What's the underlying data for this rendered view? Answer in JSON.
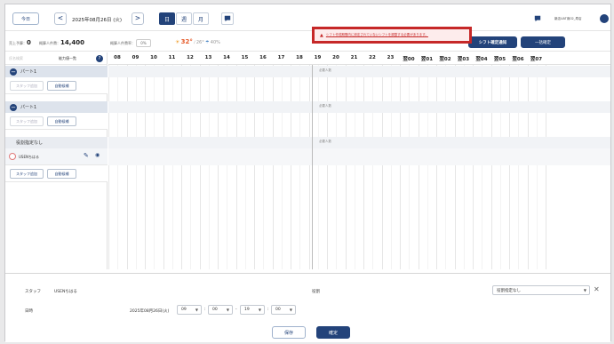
{
  "header": {
    "today_label": "今日",
    "prev_label": "<",
    "next_label": ">",
    "date": "2025年08月26日 (火)",
    "view_tabs": [
      "日",
      "週",
      "月"
    ],
    "user_name": "新店UAT用02_寿店"
  },
  "stats": {
    "sales_label": "売上予算：",
    "sales_value": "0",
    "labor_cost_label": "概算人件費：",
    "labor_cost_value": "14,400",
    "labor_ratio_label": "概算人件費率：",
    "labor_ratio_value": "0%",
    "weather_temp_high": "32°",
    "weather_temp_low": "26°",
    "weather_rain": "40%",
    "confirm_notice_label": "シフト確定通知",
    "bulk_confirm_label": "一括確定"
  },
  "alert": {
    "text": "シフト作成期間内に設定されていないシフトを調整する必要があります。"
  },
  "left_panel": {
    "search_placeholder": "氏名検索",
    "skill_filter_label": "能力値一覧",
    "groups": [
      {
        "name": "パート1"
      },
      {
        "name": "パート1"
      },
      {
        "name": "役割指定なし"
      }
    ],
    "add_staff_label": "スタッフ追加",
    "auto_assign_label": "自動候補",
    "staff_name": "USENちはる"
  },
  "timeline": {
    "hours": [
      "08",
      "09",
      "10",
      "11",
      "12",
      "13",
      "14",
      "15",
      "16",
      "17",
      "18",
      "19",
      "20",
      "21",
      "22",
      "23",
      "翌00",
      "翌01",
      "翌02",
      "翌03",
      "翌04",
      "翌05",
      "翌06",
      "翌07"
    ],
    "required_label": "必要人数"
  },
  "bottom_panel": {
    "staff_label": "スタッフ",
    "staff_value": "USENちはる",
    "role_label": "役割",
    "role_value": "役割指定なし",
    "datetime_label": "日時",
    "date_value": "2025年08月26日(火)",
    "start_hour": "09",
    "start_min": "00",
    "end_hour": "19",
    "end_min": "00",
    "save_label": "保存",
    "confirm_label": "確定"
  },
  "colors": {
    "primary": "#23437a",
    "alert_red": "#c62828",
    "group_bg": "#dde3ec",
    "staff_icon": "#e07a7a"
  }
}
